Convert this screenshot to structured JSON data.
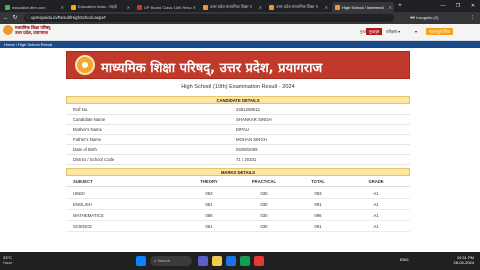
{
  "browser": {
    "tabs": [
      {
        "label": "education.lifre.com",
        "fav": "#4caf50"
      },
      {
        "label": "Education India - पढ़ाई",
        "fav": "#f9ab00"
      },
      {
        "label": "UP Board Class 10th Resu",
        "fav": "#d93025"
      },
      {
        "label": "उत्तर प्रदेश माध्यमिक शिक्षा प",
        "fav": "#ec9a2f"
      },
      {
        "label": "उत्तर प्रदेश माध्यमिक शिक्षा प",
        "fav": "#ec9a2f"
      },
      {
        "label": "High School / Intermedi",
        "fav": "#ec9a2f"
      }
    ],
    "new_tab": "+",
    "url": "upmspuldu.in/Result/HighSchool.aspx#",
    "profile": "Incognito (2)",
    "window_controls": [
      "—",
      "❐",
      "✕"
    ]
  },
  "site": {
    "org_hindi_1": "माध्यमिक शिक्षा परिषद्",
    "org_hindi_2": "उत्तर प्रदेश, प्रयागराज",
    "nav": {
      "home": "मुख्य",
      "btn_red": "मुखपृष्ठ",
      "pariksha": "परीक्षाएं ▾",
      "dropdown": "▾",
      "btn_orange": "महत्वपूर्ण लिंक"
    },
    "breadcrumb": "Home  /  High School Result",
    "banner_text": "माध्यमिक शिक्षा परिषद्, उत्तर प्रदेश, प्रयागराज",
    "exam_title": "High School (10th) Examination Result - 2024",
    "candidate_heading": "CANDIDATE DETAILS",
    "candidate": [
      {
        "label": "Roll No.",
        "value": "2451208612"
      },
      {
        "label": "Candidate Name",
        "value": "SHANKAR SINGH"
      },
      {
        "label": "Mother's Name",
        "value": "DIPALI"
      },
      {
        "label": "Father's Name",
        "value": "MOHAN SINGH"
      },
      {
        "label": "Date of Birth",
        "value": "04/09/2009"
      },
      {
        "label": "District / School Code",
        "value": "71 / 20101"
      }
    ],
    "marks_heading": "MARKS DETAILS",
    "marks_columns": [
      "SUBJECT",
      "THEORY",
      "PRACTICAL",
      "TOTAL",
      "GRADE"
    ],
    "marks": [
      [
        "HINDI",
        "063",
        "030",
        "093",
        "A1"
      ],
      [
        "ENGLISH",
        "061",
        "030",
        "091",
        "A1"
      ],
      [
        "MATHEMATICS",
        "066",
        "030",
        "096",
        "A1"
      ],
      [
        "SCIENCE",
        "061",
        "030",
        "091",
        "A1"
      ]
    ]
  },
  "taskbar": {
    "temp": "33°C",
    "weather": "Haze",
    "search": "Search",
    "tray": "ENG",
    "time": "10:31 PM",
    "date": "28-04-2024"
  }
}
